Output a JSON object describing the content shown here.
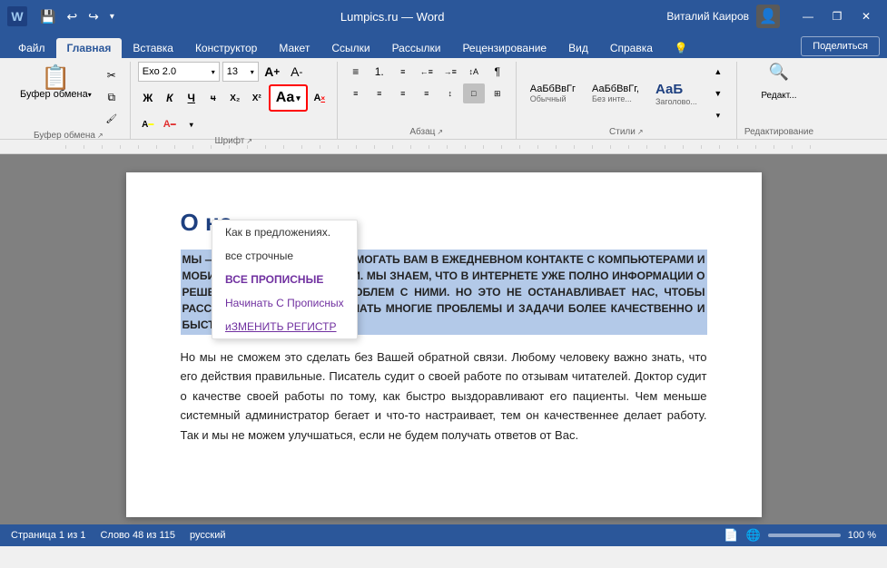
{
  "titleBar": {
    "appIcon": "W",
    "quickAccess": [
      "💾",
      "↩",
      "↪",
      "▾"
    ],
    "title": "Lumpics.ru — Word",
    "userName": "Виталий Каиров",
    "windowControls": [
      "—",
      "❐",
      "✕"
    ]
  },
  "ribbonTabs": {
    "tabs": [
      "Файл",
      "Главная",
      "Вставка",
      "Конструктор",
      "Макет",
      "Ссылки",
      "Рассылки",
      "Рецензирование",
      "Вид",
      "Справка",
      "💡"
    ],
    "rightTabs": [
      "Поделиться"
    ],
    "activeTab": "Главная"
  },
  "ribbon": {
    "groups": [
      {
        "name": "Буфер обмена",
        "label": "Буфер обмена"
      },
      {
        "name": "Шрифт",
        "label": "Шрифт",
        "font": "Exo 2.0",
        "size": "13"
      },
      {
        "name": "Абзац",
        "label": "Абзац"
      },
      {
        "name": "Стили",
        "label": "Стили"
      },
      {
        "name": "Редактирование",
        "label": "Редактирование"
      }
    ]
  },
  "fontGroup": {
    "fontName": "Exo 2.0",
    "fontSize": "13",
    "boldLabel": "Ж",
    "italicLabel": "К",
    "underlineLabel": "Ч",
    "aaLabel": "Aa",
    "aaArrow": "▾"
  },
  "dropdownMenu": {
    "items": [
      {
        "id": "sentence",
        "label": "Как в предложениях."
      },
      {
        "id": "lower",
        "label": "все строчные"
      },
      {
        "id": "upper",
        "label": "ВСЕ ПРОПИСНЫЕ"
      },
      {
        "id": "title",
        "label": "Начинать С Прописных"
      },
      {
        "id": "toggle",
        "label": "иЗМЕНИТЬ РЕГИСТР"
      }
    ]
  },
  "stylesGroup": {
    "styles": [
      {
        "label": "АаБбВвГг",
        "name": "Обычный"
      },
      {
        "label": "АаБбВвГг,",
        "name": "Без инте..."
      },
      {
        "label": "АаБ",
        "name": "Заголово..."
      }
    ]
  },
  "document": {
    "heading": "О на",
    "selectedParagraph": "МЫ — ОДЕРЖИМЫЕ ИДЕЕЙ ПОМОГАТЬ ВАМ В ЕЖЕДНЕВНОМ КОНТАКТЕ С КОМПЬЮТЕРАМИ И МОБИЛЬНЫМИ УСТРОЙСТВАМИ. МЫ ЗНАЕМ, ЧТО В ИНТЕРНЕТЕ УЖЕ ПОЛНО ИНФОРМАЦИИ О РЕШЕНИИ РАЗНОГО РОДА ПРОБЛЕМ С НИМИ. НО ЭТО НЕ ОСТАНАВЛИВАЕТ НАС, ЧТОБЫ РАССКАЗЫВАТЬ ВАМ, КАК РЕШАТЬ МНОГИЕ ПРОБЛЕМЫ И ЗАДАЧИ БОЛЕЕ КАЧЕСТВЕННО И БЫСТРЕЕ.",
    "bodyText": "Но мы не сможем это сделать без Вашей обратной связи. Любому человеку важно знать, что его действия правильные. Писатель судит о своей работе по отзывам читателей. Доктор судит о качестве своей работы по тому, как быстро выздоравливают его пациенты. Чем меньше системный администратор бегает и что-то настраивает, тем он качественнее делает работу. Так и мы не можем улучшаться, если не будем получать ответов от Вас."
  },
  "statusBar": {
    "page": "Страница 1 из 1",
    "words": "Слово 48 из 115",
    "language": "русский",
    "zoom": "100 %"
  }
}
